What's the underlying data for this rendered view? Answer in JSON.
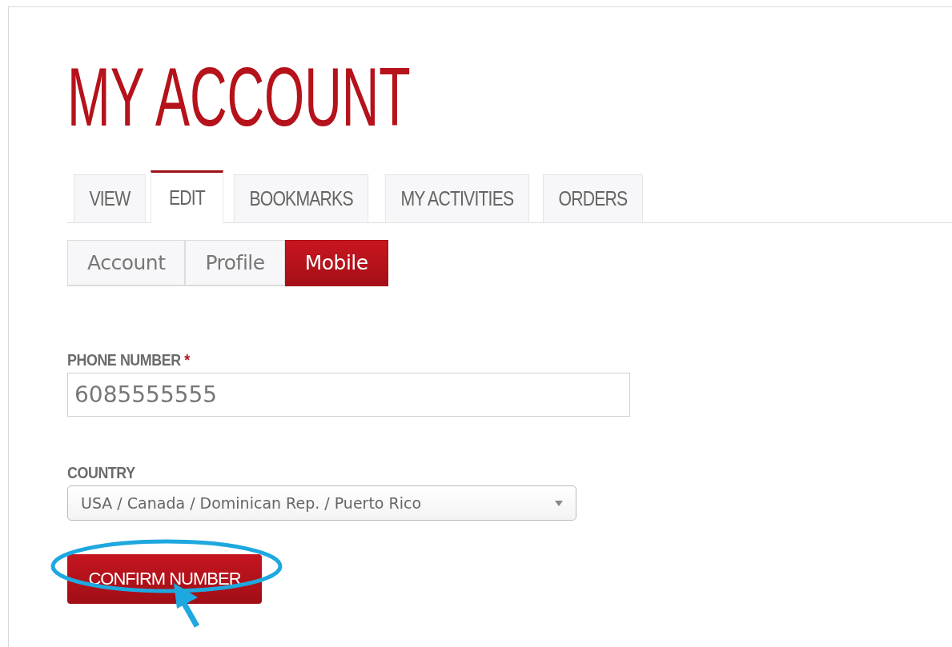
{
  "title": "MY ACCOUNT",
  "tabs": [
    {
      "label": "VIEW",
      "selected": false
    },
    {
      "label": "EDIT",
      "selected": true
    },
    {
      "label": "BOOKMARKS",
      "selected": false
    },
    {
      "label": "MY ACTIVITIES",
      "selected": false
    },
    {
      "label": "ORDERS",
      "selected": false
    }
  ],
  "subtabs": [
    {
      "label": "Account",
      "selected": false
    },
    {
      "label": "Profile",
      "selected": false
    },
    {
      "label": "Mobile",
      "selected": true
    }
  ],
  "phone": {
    "label": "PHONE NUMBER",
    "required_mark": "*",
    "value": "6085555555"
  },
  "country": {
    "label": "COUNTRY",
    "value": "USA / Canada / Dominican Rep. / Puerto Rico"
  },
  "button": {
    "label": "CONFIRM NUMBER"
  }
}
